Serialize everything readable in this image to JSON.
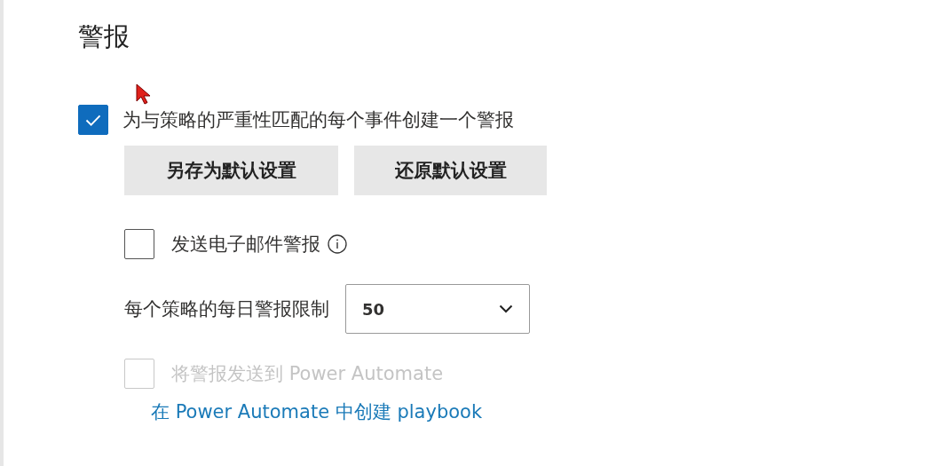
{
  "section": {
    "title": "警报"
  },
  "create_alert": {
    "label": "为与策略的严重性匹配的每个事件创建一个警报",
    "checked": true
  },
  "buttons": [
    "另存为默认设置",
    "还原默认设置"
  ],
  "options": [
    {
      "kind": "checkbox",
      "label": "发送电子邮件警报",
      "checked": false,
      "disabled": false,
      "info": true
    },
    {
      "kind": "select",
      "label": "每个策略的每日警报限制",
      "value": "50"
    },
    {
      "kind": "checkbox",
      "label": "将警报发送到 Power Automate",
      "checked": false,
      "disabled": true,
      "info": false
    }
  ],
  "link": "在 Power Automate 中创建 playbook"
}
